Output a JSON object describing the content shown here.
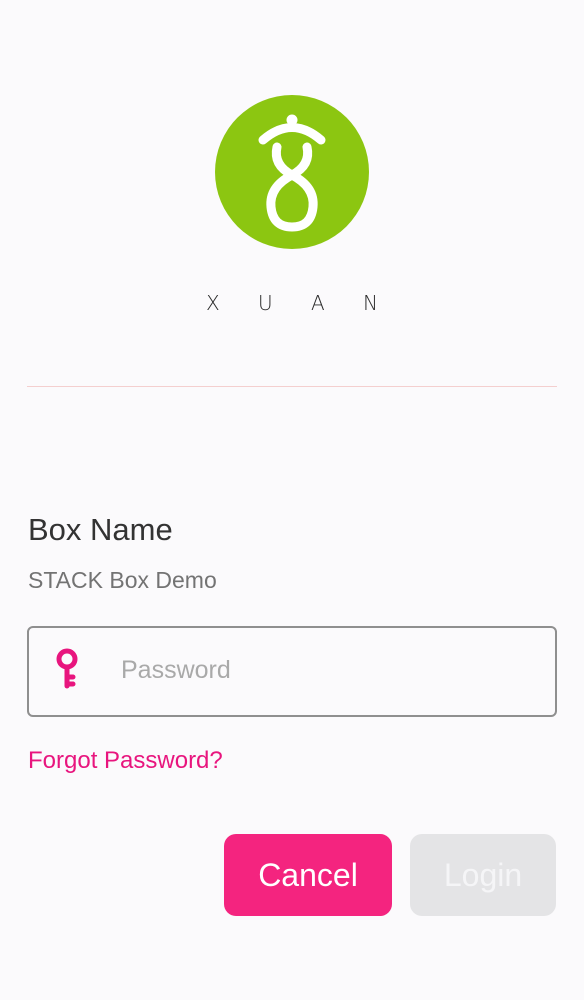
{
  "brand": {
    "wordmark_letters": [
      "X",
      "U",
      "A",
      "N"
    ],
    "accent_color": "#8cc611",
    "logo_icon": "xuan-logo-icon"
  },
  "form": {
    "box_name_label": "Box Name",
    "box_name_value": "STACK Box Demo",
    "password": {
      "value": "",
      "placeholder": "Password",
      "icon": "key-icon"
    },
    "forgot_password_label": "Forgot Password?"
  },
  "actions": {
    "cancel_label": "Cancel",
    "login_label": "Login"
  },
  "colors": {
    "primary_pink": "#f4247f",
    "link_pink": "#e8157e",
    "disabled_gray": "#e4e4e6"
  }
}
